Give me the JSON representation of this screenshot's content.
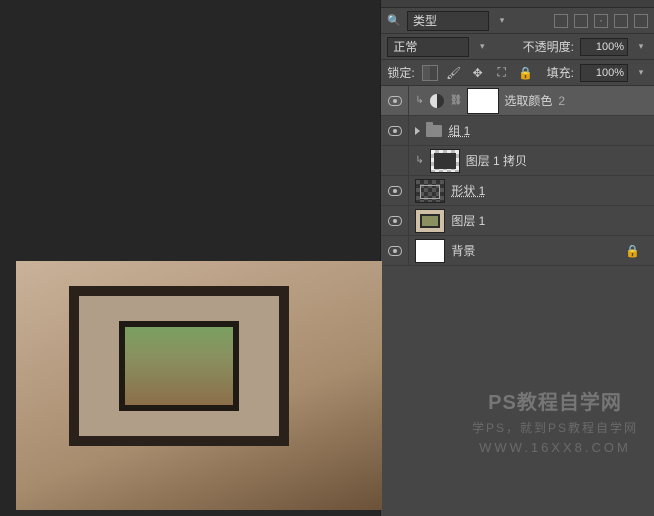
{
  "blend_mode": "正常",
  "opacity_label": "不透明度:",
  "opacity_value": "100%",
  "lock_label": "锁定:",
  "fill_label": "填充:",
  "fill_value": "100%",
  "layers": [
    {
      "name": "选取颜色",
      "suffix": "2"
    },
    {
      "name": "组 1"
    },
    {
      "name": "图层 1 拷贝"
    },
    {
      "name": "形状 1"
    },
    {
      "name": "图层 1"
    },
    {
      "name": "背景"
    }
  ],
  "watermark": {
    "title": "PS教程自学网",
    "subtitle": "学PS，就到PS教程自学网",
    "url": "WWW.16XX8.COM"
  }
}
